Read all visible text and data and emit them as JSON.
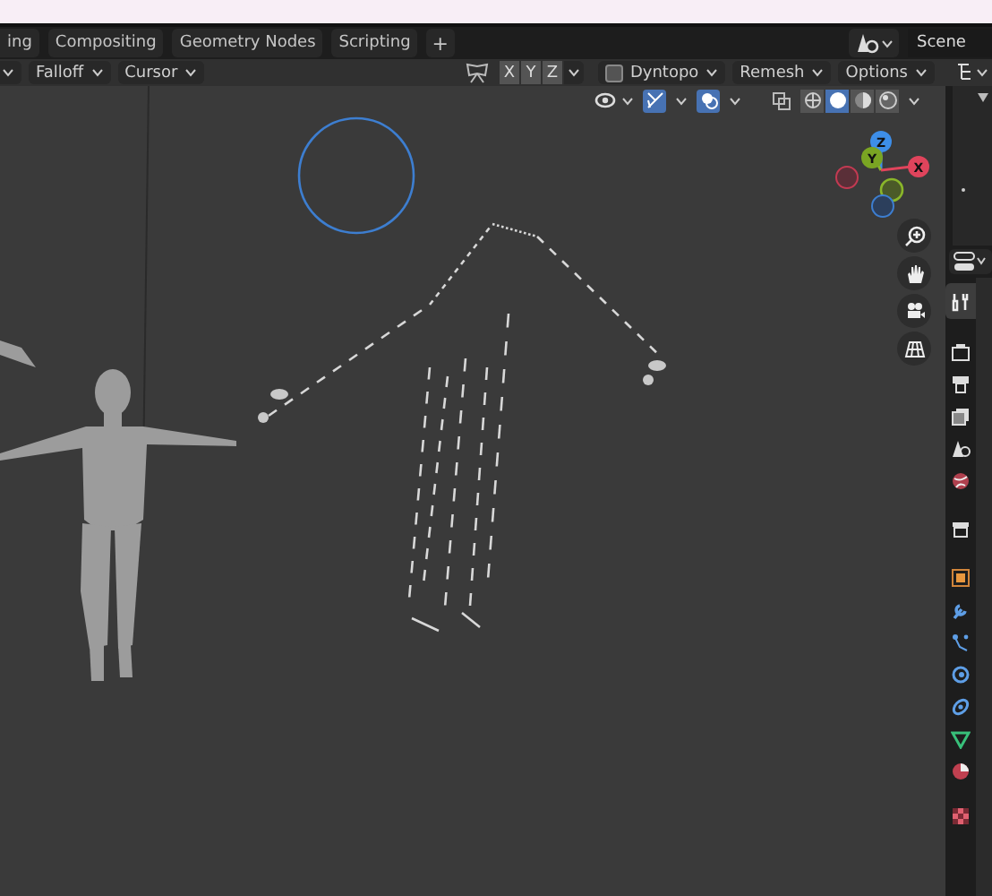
{
  "workspace_tabs": [
    {
      "label": "ing",
      "selected": false
    },
    {
      "label": "Compositing",
      "selected": false
    },
    {
      "label": "Geometry Nodes",
      "selected": false
    },
    {
      "label": "Scripting",
      "selected": false
    }
  ],
  "add_tab": "+",
  "scene": {
    "name": "Scene"
  },
  "tool_header": {
    "left_dropdowns": [
      "Falloff",
      "Cursor"
    ],
    "symmetry": [
      {
        "label": "X",
        "on": false
      },
      {
        "label": "Y",
        "on": false
      },
      {
        "label": "Z",
        "on": false
      }
    ],
    "dyntopo": {
      "label": "Dyntopo",
      "checked": false
    },
    "remesh": "Remesh",
    "options": "Options"
  },
  "viewport_header": {
    "gizmos_on": true,
    "overlays_on": true,
    "xray_on": false,
    "shading_modes": [
      {
        "selected": false
      },
      {
        "selected": true
      },
      {
        "selected": false
      },
      {
        "selected": false
      }
    ]
  },
  "axis_gizmo": {
    "x": "X",
    "y": "Y",
    "z": "Z"
  },
  "properties_tabs": [
    {
      "kind": "tool",
      "selected": true
    },
    {
      "kind": "render",
      "selected": false
    },
    {
      "kind": "output",
      "selected": false
    },
    {
      "kind": "view_layer",
      "selected": false
    },
    {
      "kind": "scene",
      "selected": false
    },
    {
      "kind": "world",
      "selected": false
    },
    {
      "kind": "collection",
      "selected": false
    },
    {
      "kind": "object",
      "selected": false
    },
    {
      "kind": "modifier",
      "selected": false
    },
    {
      "kind": "particles",
      "selected": false
    },
    {
      "kind": "physics",
      "selected": false
    },
    {
      "kind": "constraints",
      "selected": false
    },
    {
      "kind": "data",
      "selected": false
    },
    {
      "kind": "material",
      "selected": false
    },
    {
      "kind": "texture",
      "selected": false
    }
  ]
}
